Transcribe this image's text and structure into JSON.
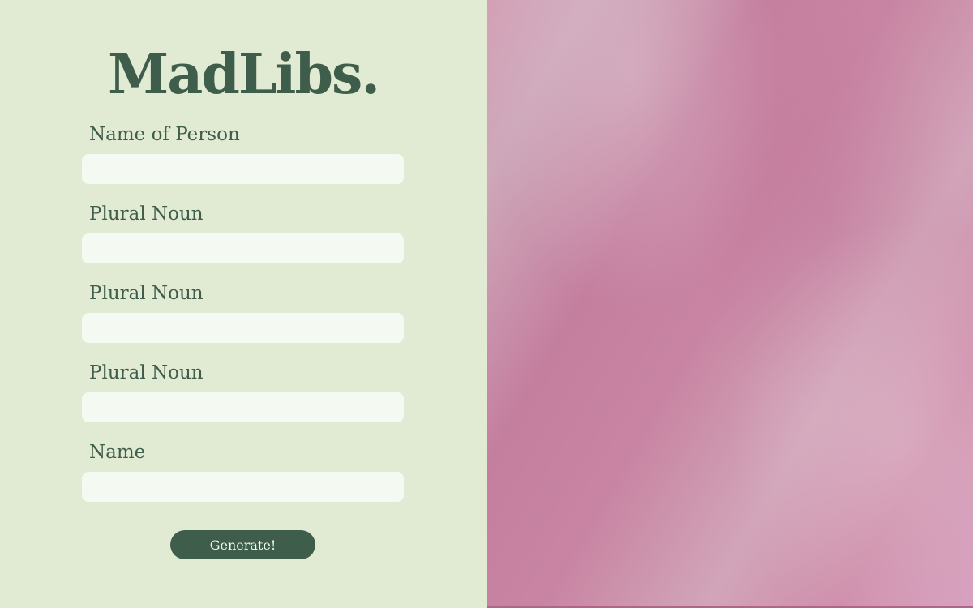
{
  "app": {
    "title": "MadLibs."
  },
  "form": {
    "fields": [
      {
        "label": "Name of Person",
        "value": "",
        "placeholder": ""
      },
      {
        "label": "Plural Noun",
        "value": "",
        "placeholder": ""
      },
      {
        "label": "Plural Noun",
        "value": "",
        "placeholder": ""
      },
      {
        "label": "Plural Noun",
        "value": "",
        "placeholder": ""
      },
      {
        "label": "Name",
        "value": "",
        "placeholder": ""
      }
    ],
    "submit_label": "Generate!"
  },
  "colors": {
    "left_background": "#e1ead2",
    "accent": "#3f5d4b",
    "input_background": "#f4f9f1",
    "right_panel_pink": "#c98aa8"
  }
}
